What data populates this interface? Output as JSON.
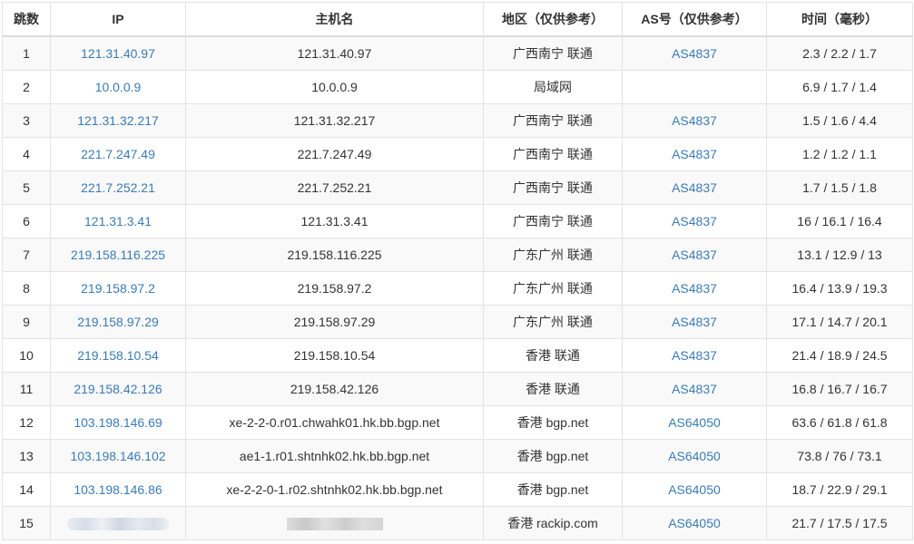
{
  "table": {
    "headers": {
      "hop": "跳数",
      "ip": "IP",
      "host": "主机名",
      "region": "地区（仅供参考）",
      "asn": "AS号（仅供参考）",
      "time": "时间（毫秒）"
    },
    "rows": [
      {
        "hop": "1",
        "ip": "121.31.40.97",
        "host": "121.31.40.97",
        "region": "广西南宁 联通",
        "asn": "AS4837",
        "time": "2.3 / 2.2 / 1.7"
      },
      {
        "hop": "2",
        "ip": "10.0.0.9",
        "host": "10.0.0.9",
        "region": "局域网",
        "asn": "",
        "time": "6.9 / 1.7 / 1.4"
      },
      {
        "hop": "3",
        "ip": "121.31.32.217",
        "host": "121.31.32.217",
        "region": "广西南宁 联通",
        "asn": "AS4837",
        "time": "1.5 / 1.6 / 4.4"
      },
      {
        "hop": "4",
        "ip": "221.7.247.49",
        "host": "221.7.247.49",
        "region": "广西南宁 联通",
        "asn": "AS4837",
        "time": "1.2 / 1.2 / 1.1"
      },
      {
        "hop": "5",
        "ip": "221.7.252.21",
        "host": "221.7.252.21",
        "region": "广西南宁 联通",
        "asn": "AS4837",
        "time": "1.7 / 1.5 / 1.8"
      },
      {
        "hop": "6",
        "ip": "121.31.3.41",
        "host": "121.31.3.41",
        "region": "广西南宁 联通",
        "asn": "AS4837",
        "time": "16 / 16.1 / 16.4"
      },
      {
        "hop": "7",
        "ip": "219.158.116.225",
        "host": "219.158.116.225",
        "region": "广东广州 联通",
        "asn": "AS4837",
        "time": "13.1 / 12.9 / 13"
      },
      {
        "hop": "8",
        "ip": "219.158.97.2",
        "host": "219.158.97.2",
        "region": "广东广州 联通",
        "asn": "AS4837",
        "time": "16.4 / 13.9 / 19.3"
      },
      {
        "hop": "9",
        "ip": "219.158.97.29",
        "host": "219.158.97.29",
        "region": "广东广州 联通",
        "asn": "AS4837",
        "time": "17.1 / 14.7 / 20.1"
      },
      {
        "hop": "10",
        "ip": "219.158.10.54",
        "host": "219.158.10.54",
        "region": "香港 联通",
        "asn": "AS4837",
        "time": "21.4 / 18.9 / 24.5"
      },
      {
        "hop": "11",
        "ip": "219.158.42.126",
        "host": "219.158.42.126",
        "region": "香港 联通",
        "asn": "AS4837",
        "time": "16.8 / 16.7 / 16.7"
      },
      {
        "hop": "12",
        "ip": "103.198.146.69",
        "host": "xe-2-2-0.r01.chwahk01.hk.bb.bgp.net",
        "region": "香港 bgp.net",
        "asn": "AS64050",
        "time": "63.6 / 61.8 / 61.8"
      },
      {
        "hop": "13",
        "ip": "103.198.146.102",
        "host": "ae1-1.r01.shtnhk02.hk.bb.bgp.net",
        "region": "香港 bgp.net",
        "asn": "AS64050",
        "time": "73.8 / 76 / 73.1"
      },
      {
        "hop": "14",
        "ip": "103.198.146.86",
        "host": "xe-2-2-0-1.r02.shtnhk02.hk.bb.bgp.net",
        "region": "香港 bgp.net",
        "asn": "AS64050",
        "time": "18.7 / 22.9 / 29.1"
      },
      {
        "hop": "15",
        "ip": "",
        "host": "",
        "region": "香港 rackip.com",
        "asn": "AS64050",
        "time": "21.7 / 17.5 / 17.5",
        "ip_redacted": true,
        "host_redacted": true
      }
    ]
  },
  "colors": {
    "link": "#3b7bb4",
    "stripe": "#f9f9f9",
    "border": "#e3e3e3"
  }
}
